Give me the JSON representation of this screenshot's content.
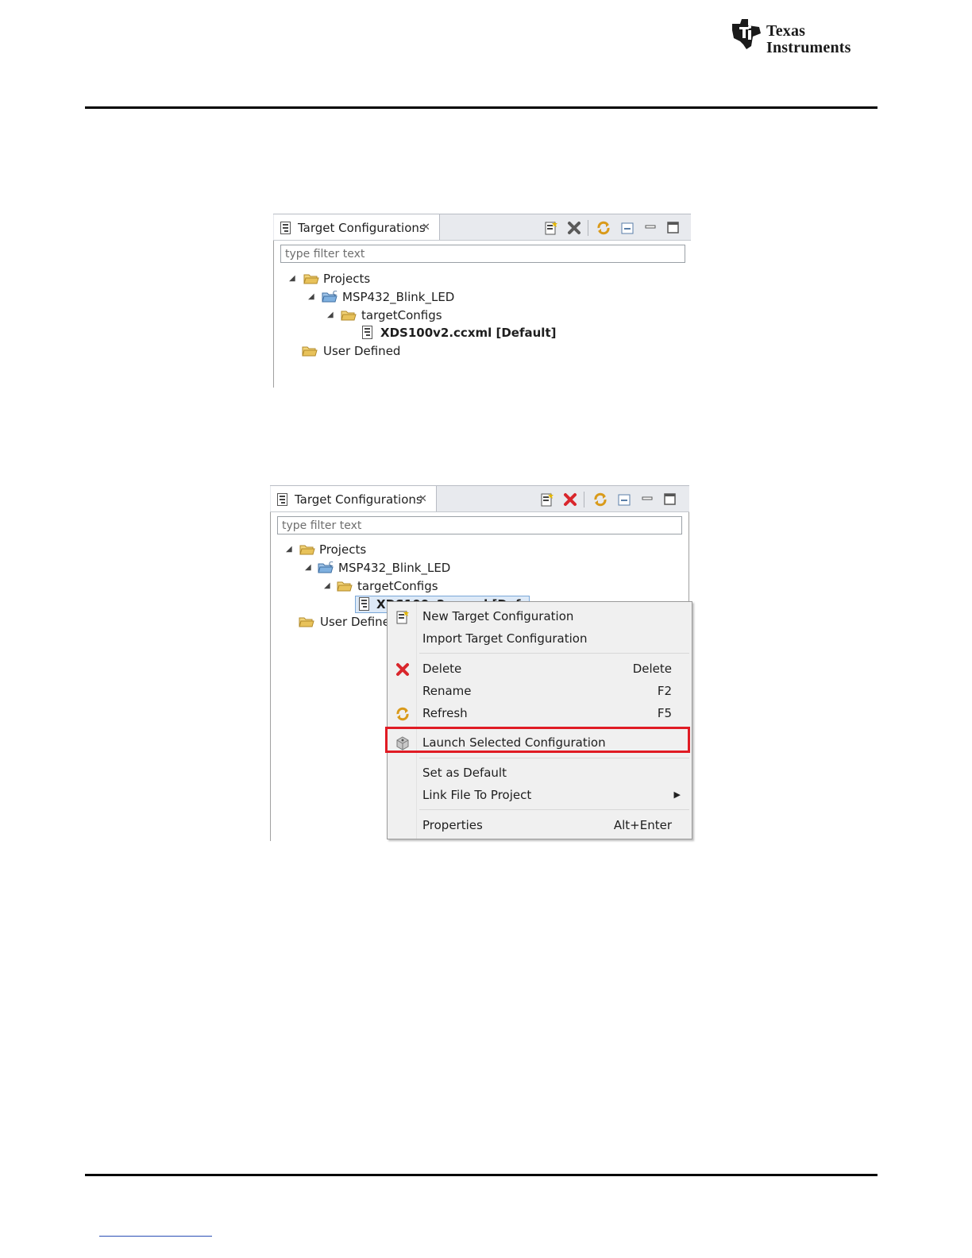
{
  "logo": {
    "line1": "Texas",
    "line2": "Instruments"
  },
  "panel_top": {
    "tab_title": "Target Configurations",
    "filter_placeholder": "type filter text",
    "tree": {
      "projects": "Projects",
      "project": "MSP432_Blink_LED",
      "folder": "targetConfigs",
      "file": "XDS100v2.ccxml [Default]",
      "user_defined": "User Defined"
    }
  },
  "panel_bottom": {
    "tab_title": "Target Configurations",
    "filter_placeholder": "type filter text",
    "tree": {
      "projects": "Projects",
      "project": "MSP432_Blink_LED",
      "folder": "targetConfigs",
      "file_partial": "XDS100v2.ccxml [Default]",
      "user_defined": "User Defined"
    }
  },
  "context_menu": {
    "items": [
      {
        "label": "New Target Configuration",
        "shortcut": ""
      },
      {
        "label": "Import Target Configuration",
        "shortcut": ""
      },
      {
        "label": "Delete",
        "shortcut": "Delete"
      },
      {
        "label": "Rename",
        "shortcut": "F2"
      },
      {
        "label": "Refresh",
        "shortcut": "F5"
      },
      {
        "label": "Launch Selected Configuration",
        "shortcut": "",
        "highlighted": true
      },
      {
        "label": "Set as Default",
        "shortcut": ""
      },
      {
        "label": "Link File To Project",
        "shortcut": "",
        "submenu": true
      },
      {
        "label": "Properties",
        "shortcut": "Alt+Enter"
      }
    ]
  },
  "colors": {
    "highlight_border": "#e01b24",
    "delete_red": "#d9262c",
    "folder_yellow": "#e8c25a"
  }
}
